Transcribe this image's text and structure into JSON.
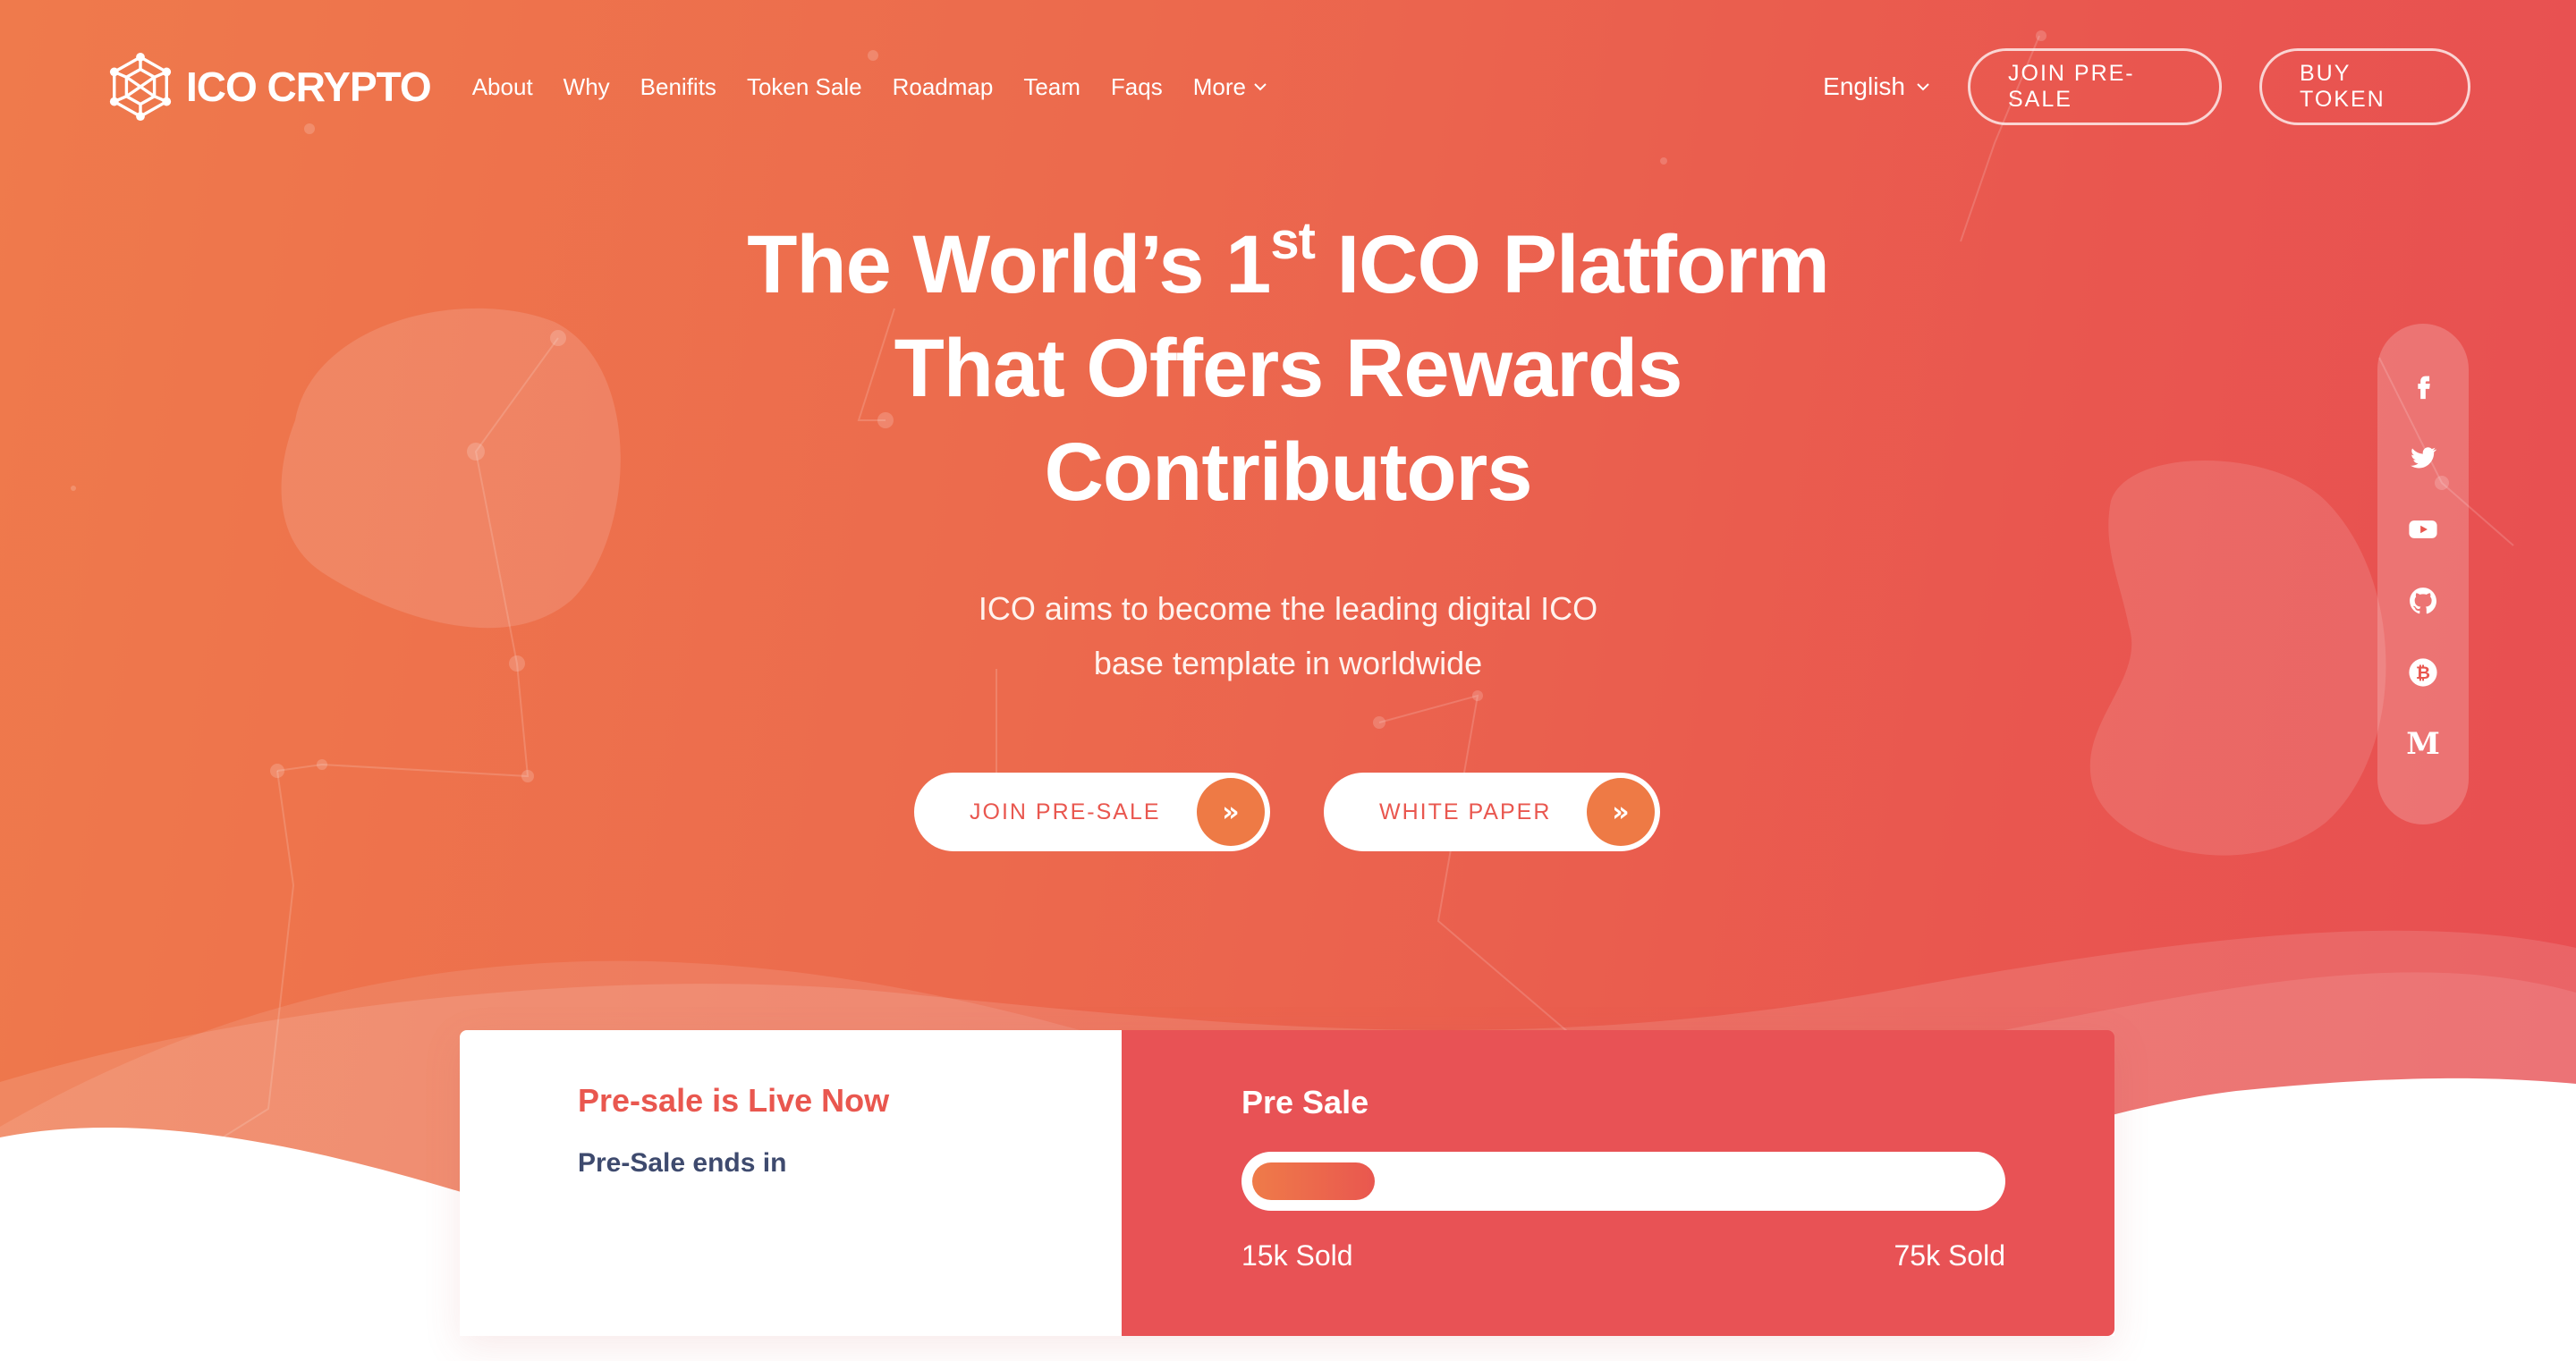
{
  "brand": {
    "name": "ICO CRYPTO",
    "logo_icon": "hexagon-cube-icon"
  },
  "nav": {
    "items": [
      "About",
      "Why",
      "Benifits",
      "Token Sale",
      "Roadmap",
      "Team",
      "Faqs"
    ],
    "more_label": "More"
  },
  "header": {
    "language": "English",
    "join_presale": "JOIN PRE-SALE",
    "buy_token": "BUY TOKEN"
  },
  "hero": {
    "title_part1": "The World’s 1",
    "title_sup": "st",
    "title_part2": " ICO Platform",
    "title_line2": "That Offers Rewards",
    "title_line3": "Contributors",
    "subtitle_line1": "ICO aims to become the leading digital ICO",
    "subtitle_line2": "base template in worldwide",
    "cta_join": "JOIN PRE-SALE",
    "cta_whitepaper": "WHITE PAPER",
    "cta_icon": "double-chevron-right-icon"
  },
  "social": [
    "facebook-icon",
    "twitter-icon",
    "youtube-icon",
    "github-icon",
    "bitcoin-icon",
    "medium-icon"
  ],
  "social_medium_letter": "M",
  "presale": {
    "live_title": "Pre-sale is Live Now",
    "ends_label": "Pre-Sale ends in",
    "title": "Pre Sale",
    "sold_label": "15k Sold",
    "target_label": "75k Sold",
    "progress_fraction": 0.165
  },
  "colors": {
    "gradient_start": "#ef7a4c",
    "gradient_end": "#e84e52",
    "accent_red": "#e9574f",
    "accent_orange": "#ee7a45",
    "navy_text": "#3e4a6e"
  }
}
